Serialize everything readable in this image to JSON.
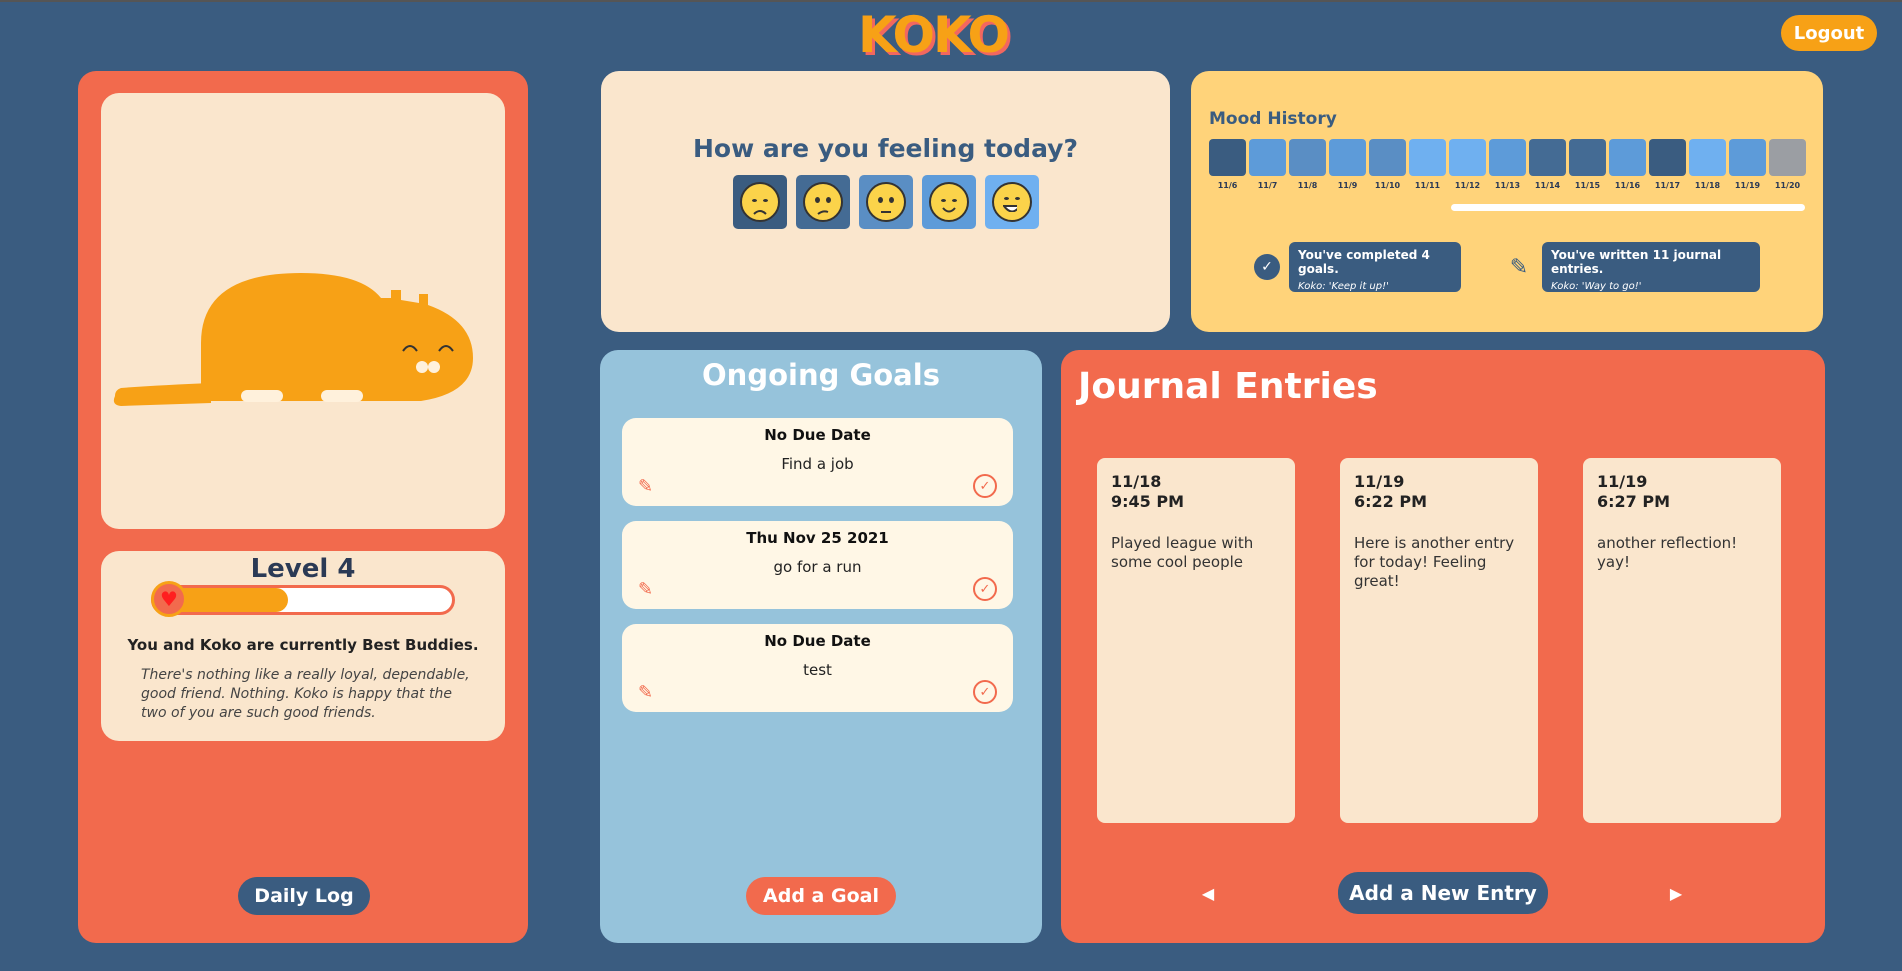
{
  "header": {
    "logo": "KOKO",
    "logout_label": "Logout"
  },
  "pet": {
    "level_label": "Level 4",
    "level_progress": 0.45,
    "status": "You and Koko are currently Best Buddies.",
    "quote": "There's nothing like a really loyal, dependable, good friend. Nothing. Koko is happy that the two of you are such good friends.",
    "daily_log_label": "Daily Log"
  },
  "mood": {
    "question": "How are you feeling today?",
    "options": [
      {
        "name": "very-sad",
        "color": "#3a5c80"
      },
      {
        "name": "sad",
        "color": "#446b94"
      },
      {
        "name": "neutral",
        "color": "#5a8ec4"
      },
      {
        "name": "happy",
        "color": "#5d9bd9"
      },
      {
        "name": "very-happy",
        "color": "#6fb0f0"
      }
    ]
  },
  "history": {
    "title": "Mood History",
    "days": [
      {
        "label": "11/6",
        "color": "#3a5c80"
      },
      {
        "label": "11/7",
        "color": "#5d9bd9"
      },
      {
        "label": "11/8",
        "color": "#5a8ec4"
      },
      {
        "label": "11/9",
        "color": "#5d9bd9"
      },
      {
        "label": "11/10",
        "color": "#5a8ec4"
      },
      {
        "label": "11/11",
        "color": "#6fb0f0"
      },
      {
        "label": "11/12",
        "color": "#6fb0f0"
      },
      {
        "label": "11/13",
        "color": "#5d9bd9"
      },
      {
        "label": "11/14",
        "color": "#446b94"
      },
      {
        "label": "11/15",
        "color": "#446b94"
      },
      {
        "label": "11/16",
        "color": "#5d9bd9"
      },
      {
        "label": "11/17",
        "color": "#3a5c80"
      },
      {
        "label": "11/18",
        "color": "#6fb0f0"
      },
      {
        "label": "11/19",
        "color": "#5d9bd9"
      },
      {
        "label": "11/20",
        "color": "#9b9ea3"
      }
    ],
    "goals_stat": {
      "title": "You've completed 4 goals.",
      "sub": "Koko: 'Keep it up!'"
    },
    "journal_stat": {
      "title": "You've written 11 journal entries.",
      "sub": "Koko: 'Way to go!'"
    }
  },
  "goals": {
    "title": "Ongoing Goals",
    "items": [
      {
        "due": "No Due Date",
        "text": "Find a job"
      },
      {
        "due": "Thu Nov 25 2021",
        "text": "go for a run"
      },
      {
        "due": "No Due Date",
        "text": "test"
      }
    ],
    "add_label": "Add a Goal"
  },
  "journal": {
    "title": "Journal Entries",
    "entries": [
      {
        "date": "11/18",
        "time": "9:45 PM",
        "body": "Played league with some cool people"
      },
      {
        "date": "11/19",
        "time": "6:22 PM",
        "body": "Here is another entry for today! Feeling great!"
      },
      {
        "date": "11/19",
        "time": "6:27 PM",
        "body": "another reflection! yay!"
      }
    ],
    "add_label": "Add a New Entry"
  }
}
